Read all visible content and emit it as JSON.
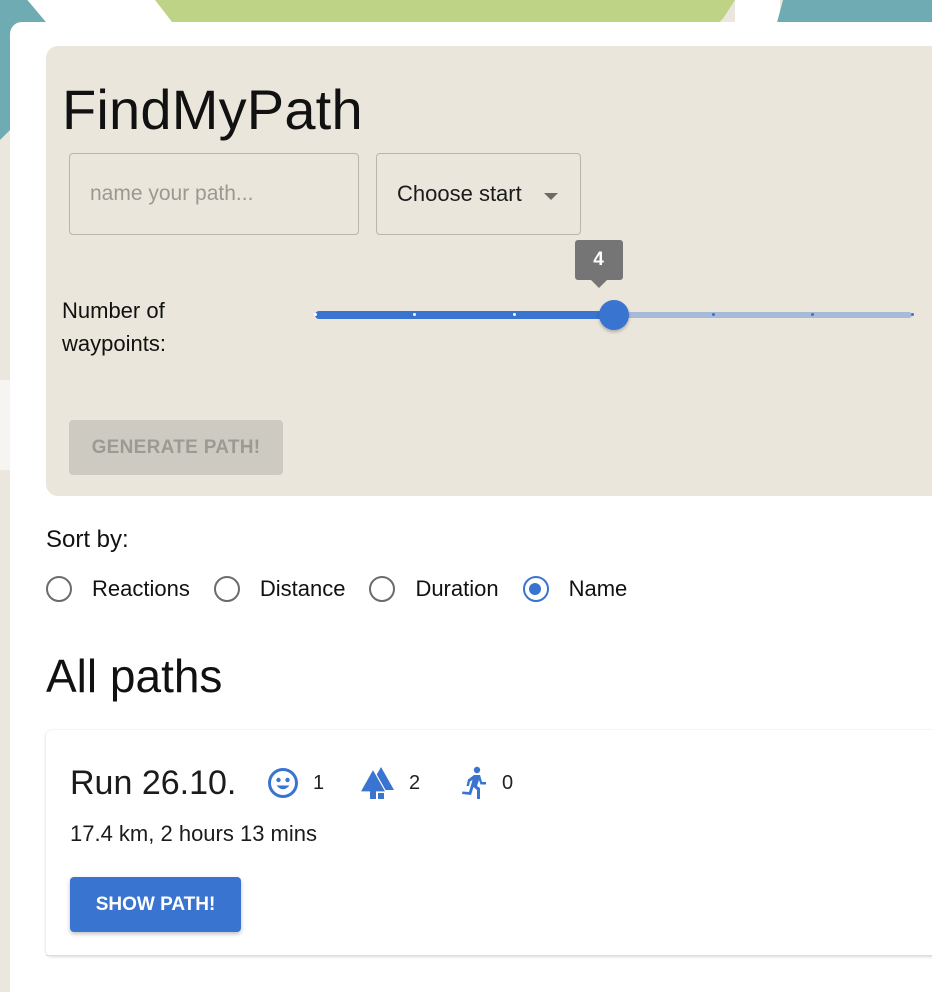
{
  "app": {
    "title": "FindMyPath"
  },
  "form": {
    "name_input": {
      "value": "",
      "placeholder": "name your path..."
    },
    "start_select": {
      "selected": "Choose start"
    },
    "waypoints": {
      "label": "Number of waypoints:",
      "min": 1,
      "max": 7,
      "step": 1,
      "value": 4,
      "value_label": "4"
    },
    "generate_button": {
      "label": "GENERATE PATH!",
      "disabled": true
    }
  },
  "sort": {
    "label": "Sort by:",
    "options": [
      {
        "label": "Reactions",
        "checked": false
      },
      {
        "label": "Distance",
        "checked": false
      },
      {
        "label": "Duration",
        "checked": false
      },
      {
        "label": "Name",
        "checked": true
      }
    ]
  },
  "paths": {
    "heading": "All paths",
    "items": [
      {
        "name": "Run 26.10.",
        "reactions": [
          {
            "icon": "smiley-face-icon",
            "count": "1"
          },
          {
            "icon": "forest-trees-icon",
            "count": "2"
          },
          {
            "icon": "running-person-icon",
            "count": "0"
          }
        ],
        "summary": "17.4 km, 2 hours 13 mins",
        "button_label": "SHOW PATH!"
      }
    ]
  },
  "colors": {
    "accent": "#3874d0",
    "accent_light": "#a7bad8",
    "card_bg": "#eae6dc",
    "disabled_bg": "#cdcac2",
    "disabled_text": "#9d9a93",
    "tooltip_bg": "#757575",
    "map_teal": "#6eabb2",
    "map_green": "#bed386"
  }
}
